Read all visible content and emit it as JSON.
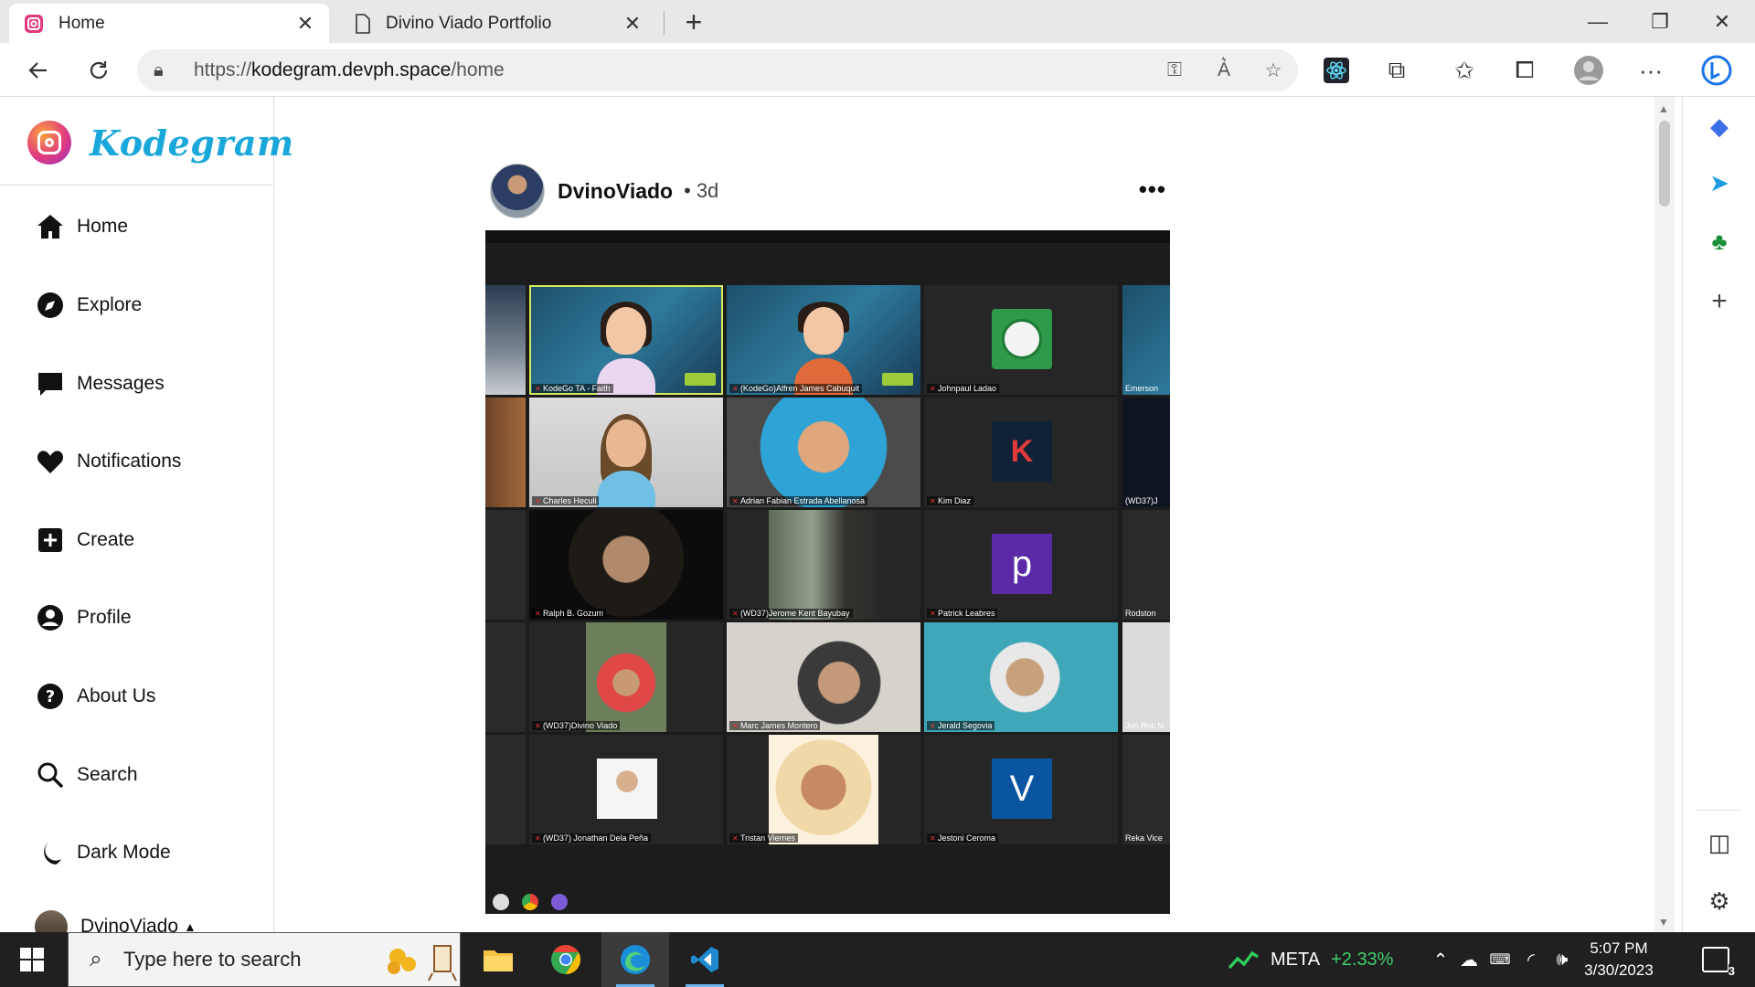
{
  "browser": {
    "tabs": [
      {
        "title": "Home",
        "active": true
      },
      {
        "title": "Divino Viado Portfolio",
        "active": false
      }
    ],
    "url_prefix": "https://",
    "url_host": "kodegram.devph.space",
    "url_path": "/home"
  },
  "app": {
    "logo_text": "Kodegram",
    "nav": [
      {
        "label": "Home",
        "icon": "home-icon"
      },
      {
        "label": "Explore",
        "icon": "compass-icon"
      },
      {
        "label": "Messages",
        "icon": "chat-bubble-icon"
      },
      {
        "label": "Notifications",
        "icon": "heart-icon"
      },
      {
        "label": "Create",
        "icon": "plus-square-icon"
      },
      {
        "label": "Profile",
        "icon": "user-icon"
      },
      {
        "label": "About Us",
        "icon": "question-icon"
      },
      {
        "label": "Search",
        "icon": "search-icon"
      },
      {
        "label": "Dark Mode",
        "icon": "moon-icon"
      }
    ],
    "current_user": "DvinoViado"
  },
  "post": {
    "username": "DvinoViado",
    "separator": "•",
    "time_ago": "3d",
    "more": "•••",
    "participants": [
      {
        "name": "KodeGo TA - Faith",
        "kind": "memoji-girl"
      },
      {
        "name": "(KodeGo)Alfren James Cabuquit",
        "kind": "memoji-boy"
      },
      {
        "name": "Johnpaul Ladao",
        "kind": "badge-green"
      },
      {
        "name": "Charles Heculi",
        "kind": "memoji-beard"
      },
      {
        "name": "Adrian Fabian Estrada Abellanosa",
        "kind": "photo-blue"
      },
      {
        "name": "Kim Diaz",
        "kind": "badge-shield"
      },
      {
        "name": "Ralph B. Gozum",
        "kind": "photo-dark"
      },
      {
        "name": "(WD37)Jerome Kent Bayubay",
        "kind": "photo-shop"
      },
      {
        "name": "Patrick Leabres",
        "kind": "letter",
        "letter": "p",
        "color": "#5b2aa8"
      },
      {
        "name": "(WD37)Divino Viado",
        "kind": "photo-red"
      },
      {
        "name": "Marc James Montero",
        "kind": "photo-room"
      },
      {
        "name": "Jerald Segovia",
        "kind": "photo-closet"
      },
      {
        "name": "(WD37) Jonathan Dela Peña",
        "kind": "photo-id"
      },
      {
        "name": "Tristan Viernes",
        "kind": "portrait"
      },
      {
        "name": "Jestoni Ceroma",
        "kind": "letter",
        "letter": "V",
        "color": "#0a55a0"
      }
    ],
    "edge_labels": {
      "r1": "Emerson",
      "r2": "(WD37)J",
      "r3": "Rodston",
      "r4": "Jon Roc N",
      "r5": "Reka Vice"
    }
  },
  "taskbar": {
    "search_placeholder": "Type here to search",
    "stock_ticker": "META",
    "stock_change": "+2.33%",
    "time": "5:07 PM",
    "date": "3/30/2023",
    "notification_count": "3"
  }
}
